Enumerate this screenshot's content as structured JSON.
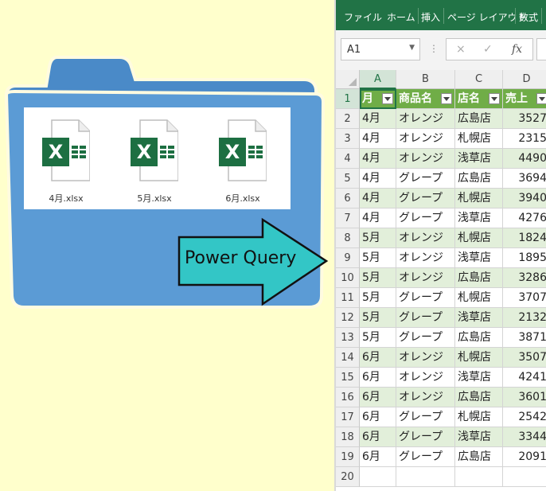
{
  "illustration": {
    "files": [
      "4月.xlsx",
      "5月.xlsx",
      "6月.xlsx"
    ],
    "arrow_label": "Power Query",
    "colors": {
      "background": "#ffffcc",
      "folder": "#5b9bd5",
      "arrow": "#33c6c6",
      "excel_green": "#1d6f42"
    }
  },
  "excel": {
    "ribbon_tabs": [
      "ファイル",
      "ホーム",
      "挿入",
      "ページ レイアウト",
      "数式"
    ],
    "name_box": "A1",
    "formula_icons": {
      "cancel": "×",
      "enter": "✓",
      "fx": "fx"
    },
    "columns": [
      "A",
      "B",
      "C",
      "D"
    ],
    "row_numbers": [
      "1",
      "2",
      "3",
      "4",
      "5",
      "6",
      "7",
      "8",
      "9",
      "10",
      "11",
      "12",
      "13",
      "14",
      "15",
      "16",
      "17",
      "18",
      "19",
      "20"
    ],
    "headers": [
      "月",
      "商品名",
      "店名",
      "売上"
    ],
    "rows": [
      [
        "4月",
        "オレンジ",
        "広島店",
        "3527"
      ],
      [
        "4月",
        "オレンジ",
        "札幌店",
        "2315"
      ],
      [
        "4月",
        "オレンジ",
        "浅草店",
        "4490"
      ],
      [
        "4月",
        "グレープ",
        "広島店",
        "3694"
      ],
      [
        "4月",
        "グレープ",
        "札幌店",
        "3940"
      ],
      [
        "4月",
        "グレープ",
        "浅草店",
        "4276"
      ],
      [
        "5月",
        "オレンジ",
        "札幌店",
        "1824"
      ],
      [
        "5月",
        "オレンジ",
        "浅草店",
        "1895"
      ],
      [
        "5月",
        "オレンジ",
        "広島店",
        "3286"
      ],
      [
        "5月",
        "グレープ",
        "札幌店",
        "3707"
      ],
      [
        "5月",
        "グレープ",
        "浅草店",
        "2132"
      ],
      [
        "5月",
        "グレープ",
        "広島店",
        "3871"
      ],
      [
        "6月",
        "オレンジ",
        "札幌店",
        "3507"
      ],
      [
        "6月",
        "オレンジ",
        "浅草店",
        "4241"
      ],
      [
        "6月",
        "オレンジ",
        "広島店",
        "3601"
      ],
      [
        "6月",
        "グレープ",
        "札幌店",
        "2542"
      ],
      [
        "6月",
        "グレープ",
        "浅草店",
        "3344"
      ],
      [
        "6月",
        "グレープ",
        "広島店",
        "2091"
      ]
    ],
    "table_colors": {
      "header": "#70ad47",
      "band": "#e2efda",
      "ribbon": "#217346"
    }
  }
}
